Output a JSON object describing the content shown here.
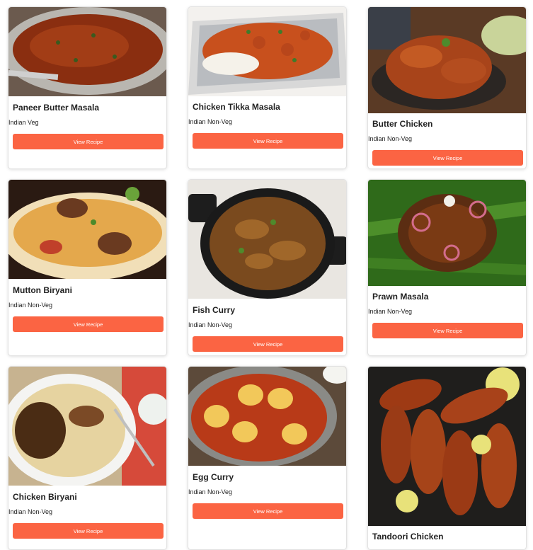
{
  "recipes": [
    {
      "title": "Paneer Butter Masala",
      "tag": "Indian Veg",
      "button": "View Recipe"
    },
    {
      "title": "Chicken Tikka Masala",
      "tag": "Indian Non-Veg",
      "button": "View Recipe"
    },
    {
      "title": "Butter Chicken",
      "tag": "Indian Non-Veg",
      "button": "View Recipe"
    },
    {
      "title": "Mutton Biryani",
      "tag": "Indian Non-Veg",
      "button": "View Recipe"
    },
    {
      "title": "Fish Curry",
      "tag": "Indian Non-Veg",
      "button": "View Recipe"
    },
    {
      "title": "Prawn Masala",
      "tag": "Indian Non-Veg",
      "button": "View Recipe"
    },
    {
      "title": "Chicken Biryani",
      "tag": "Indian Non-Veg",
      "button": "View Recipe"
    },
    {
      "title": "Egg Curry",
      "tag": "Indian Non-Veg",
      "button": "View Recipe"
    },
    {
      "title": "Tandoori Chicken",
      "tag": "",
      "button": ""
    }
  ],
  "theme": {
    "button_color": "#fb6443"
  }
}
